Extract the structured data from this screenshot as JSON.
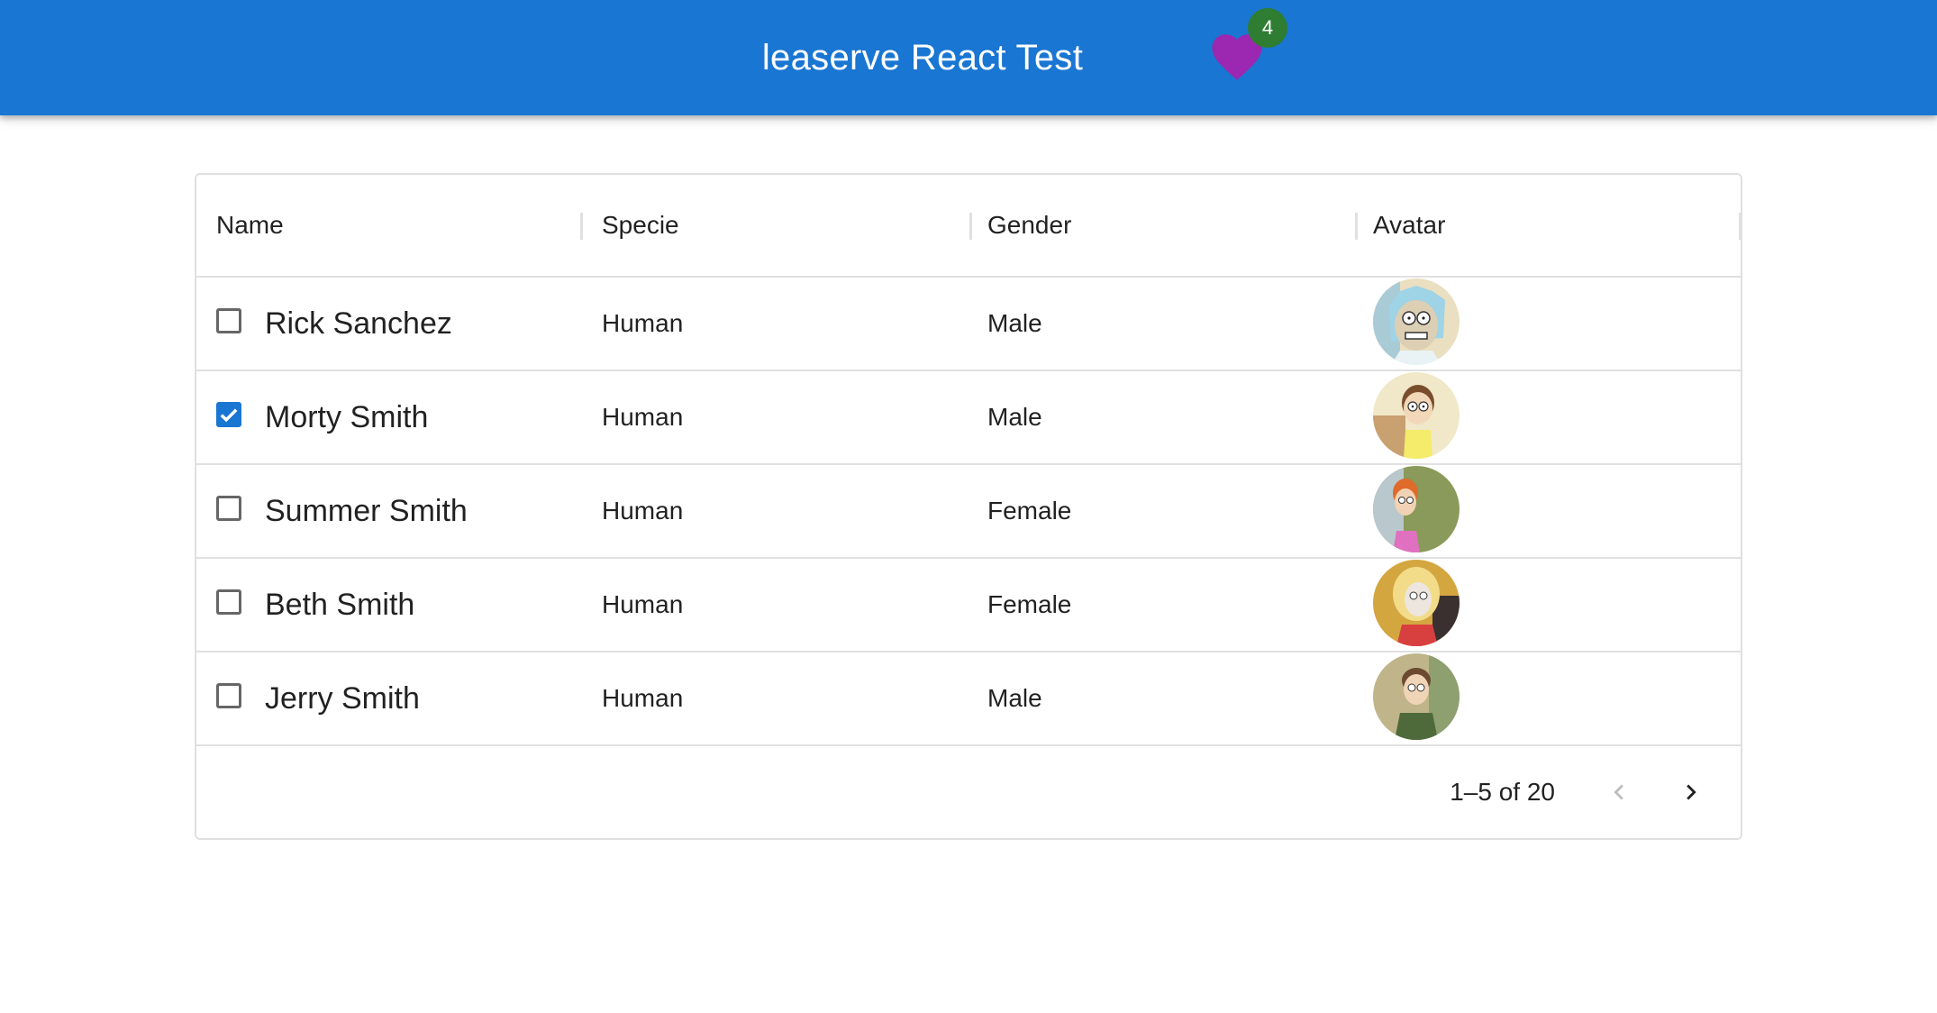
{
  "appbar": {
    "title": "leaserve React Test",
    "favorites_count": "4"
  },
  "colors": {
    "appbar": "#1976d2",
    "heart": "#9c27b0",
    "badge": "#2e7d32",
    "checkbox_checked": "#1976d2"
  },
  "grid": {
    "columns": [
      "Name",
      "Specie",
      "Gender",
      "Avatar"
    ],
    "rows": [
      {
        "name": "Rick Sanchez",
        "specie": "Human",
        "gender": "Male",
        "checked": false,
        "avatar_icon": "rick-avatar"
      },
      {
        "name": "Morty Smith",
        "specie": "Human",
        "gender": "Male",
        "checked": true,
        "avatar_icon": "morty-avatar"
      },
      {
        "name": "Summer Smith",
        "specie": "Human",
        "gender": "Female",
        "checked": false,
        "avatar_icon": "summer-avatar"
      },
      {
        "name": "Beth Smith",
        "specie": "Human",
        "gender": "Female",
        "checked": false,
        "avatar_icon": "beth-avatar"
      },
      {
        "name": "Jerry Smith",
        "specie": "Human",
        "gender": "Male",
        "checked": false,
        "avatar_icon": "jerry-avatar"
      }
    ],
    "pagination": {
      "label": "1–5 of 20",
      "prev_icon": "chevron-left-icon",
      "next_icon": "chevron-right-icon",
      "prev_disabled": true
    }
  }
}
